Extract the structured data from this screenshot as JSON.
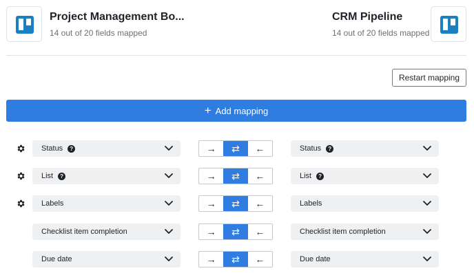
{
  "source": {
    "title": "Project Management Bo...",
    "subtitle": "14 out of 20 fields mapped",
    "logo": "trello-icon"
  },
  "target": {
    "title": "CRM Pipeline",
    "subtitle": "14 out of 20 fields mapped",
    "logo": "trello-icon"
  },
  "toolbar": {
    "restart_label": "Restart mapping",
    "add_label": "Add mapping",
    "add_icon": "+"
  },
  "direction": {
    "left": "→",
    "both": "⇄",
    "right": "←"
  },
  "colors": {
    "accent": "#2f7de1",
    "brand": "#1c7fc2",
    "field_bg": "#eef0f2"
  },
  "mappings": [
    {
      "left": "Status",
      "right": "Status",
      "left_help": "?",
      "right_help": "?",
      "gear": true,
      "active": "both"
    },
    {
      "left": "List",
      "right": "List",
      "left_help": "?",
      "right_help": "?",
      "gear": true,
      "active": "both"
    },
    {
      "left": "Labels",
      "right": "Labels",
      "gear": true,
      "active": "both"
    },
    {
      "left": "Checklist item completion",
      "right": "Checklist item completion",
      "gear": false,
      "active": "both"
    },
    {
      "left": "Due date",
      "right": "Due date",
      "gear": false,
      "active": "both"
    }
  ]
}
